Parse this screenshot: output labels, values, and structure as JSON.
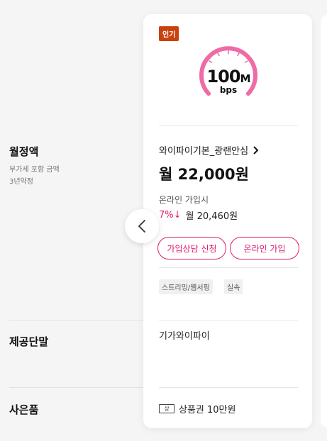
{
  "labels": {
    "monthly": "월정액",
    "monthly_sub1": "부가세 포함 금액",
    "monthly_sub2": "3년약정",
    "device": "제공단말",
    "gift": "사은품"
  },
  "card": {
    "badge": "인기",
    "speed_value": "100",
    "speed_suffix": "M",
    "speed_unit": "bps",
    "plan_name": "와이파이기본_광랜안심",
    "price": "월 22,000원",
    "online_label": "온라인 가입시",
    "discount_pct": "7%",
    "discount_arrow": "↓",
    "discount_price": "월 20,460원",
    "btn_consult": "가입상담 신청",
    "btn_join": "온라인 가입",
    "tags": [
      "스트리밍/웹서핑",
      "실속"
    ],
    "device": "기가와이파이",
    "gift_icon_text": "상",
    "gift": "상품권 10만원"
  },
  "colors": {
    "accent": "#e0196e",
    "badge": "#c9410d",
    "gauge": "#f06aa6"
  },
  "icons": {
    "prev": "chevron-left-icon",
    "plan_link": "chevron-right-icon",
    "gift": "gift-card-icon"
  }
}
